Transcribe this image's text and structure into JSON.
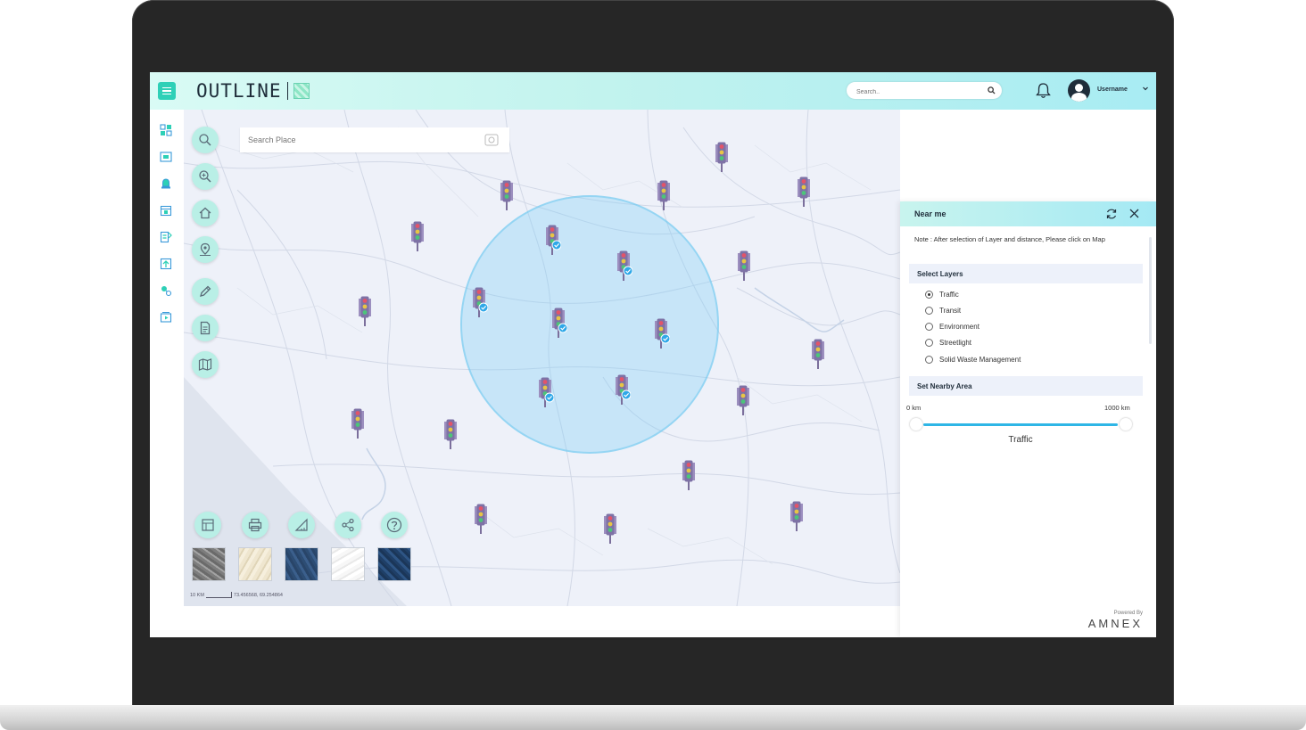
{
  "app": {
    "logo_text": "OUTLINE",
    "top_search_placeholder": "Search..",
    "username": "Username",
    "accent": "#2ed0b7"
  },
  "sidebar": {
    "items": [
      {
        "icon": "dashboard-icon"
      },
      {
        "icon": "layers-icon"
      },
      {
        "icon": "alert-icon"
      },
      {
        "icon": "calendar-icon"
      },
      {
        "icon": "report-icon"
      },
      {
        "icon": "import-icon"
      },
      {
        "icon": "analysis-icon"
      },
      {
        "icon": "video-icon"
      }
    ]
  },
  "map": {
    "place_search_placeholder": "Search Place",
    "tools": [
      "search-icon",
      "zoom-icon",
      "home-icon",
      "location-icon",
      "draw-icon",
      "document-icon",
      "map-layers-icon"
    ],
    "bottom_tools": [
      "legend-icon",
      "print-icon",
      "measure-icon",
      "share-icon",
      "help-icon"
    ],
    "basemaps": [
      "satellite",
      "terrain",
      "dark-blue",
      "light",
      "navy"
    ],
    "scale_label": "10 KM",
    "coordinates": "73.456568, 69.254864"
  },
  "panel": {
    "title": "Near me",
    "note": "Note : After selection of Layer and distance, Please click on Map",
    "select_layers_label": "Select Layers",
    "layers": [
      {
        "label": "Traffic",
        "selected": true
      },
      {
        "label": "Transit",
        "selected": false
      },
      {
        "label": "Environment",
        "selected": false
      },
      {
        "label": "Streetlight",
        "selected": false
      },
      {
        "label": "Solid Waste Management",
        "selected": false
      }
    ],
    "nearby_label": "Set Nearby Area",
    "range_min": "0 km",
    "range_max": "1000 km",
    "slider_caption": "Traffic"
  },
  "footer": {
    "powered_by": "Powered By",
    "brand": "AMNEX"
  }
}
